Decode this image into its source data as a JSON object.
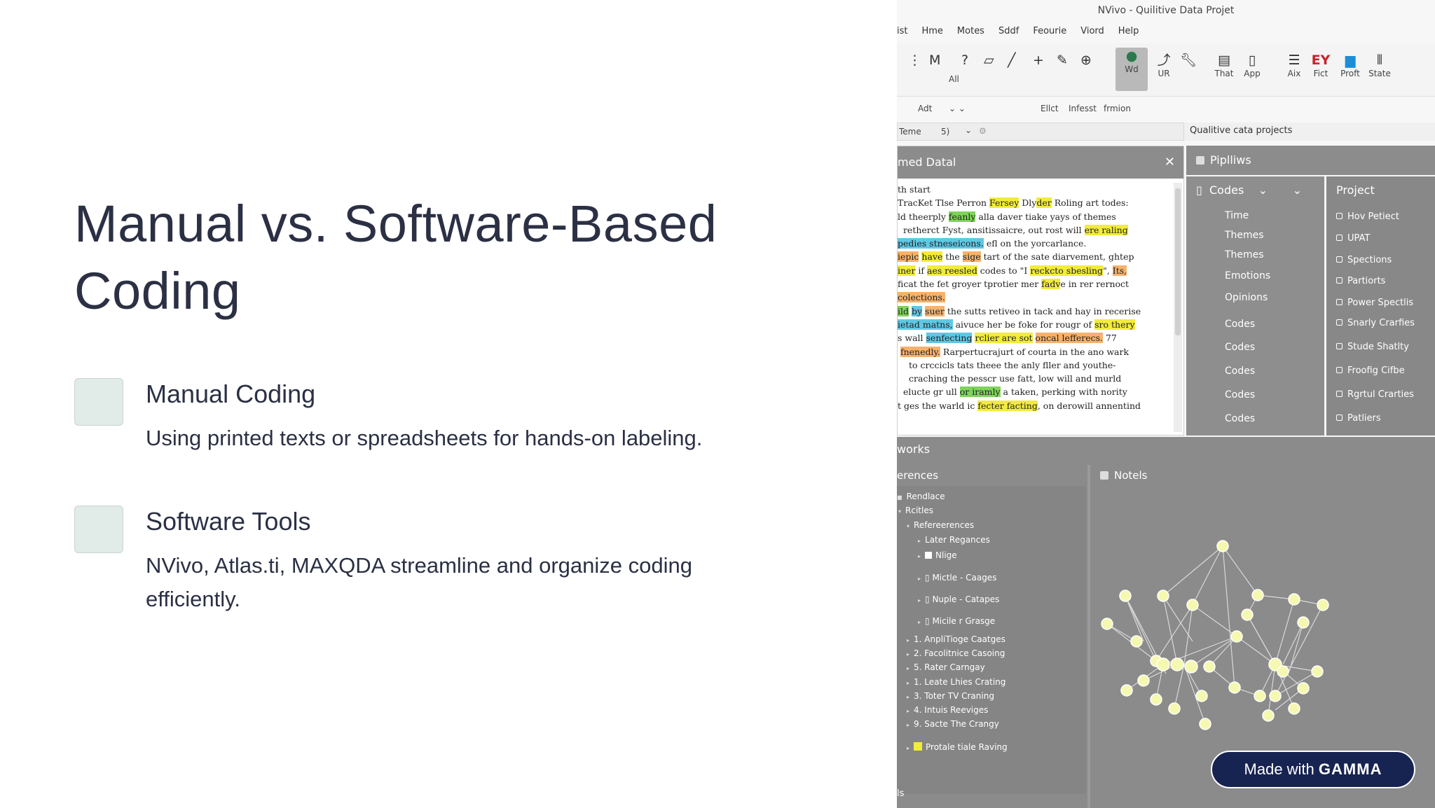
{
  "slide": {
    "title": "Manual vs. Software-Based Coding",
    "items": [
      {
        "heading": "Manual Coding",
        "description": "Using printed texts or spreadsheets for hands-on labeling."
      },
      {
        "heading": "Software Tools",
        "description": "NVivo, Atlas.ti, MAXQDA streamline and organize coding efficiently."
      }
    ]
  },
  "screenshot": {
    "window_title": "NVivo - Quilitive Data Projet",
    "menu": [
      "ist",
      "Hme",
      "Motes",
      "Sddf",
      "Feourie",
      "Viord",
      "Help"
    ],
    "ribbon": {
      "buttons": [
        "Wd",
        "UR",
        "That",
        "App",
        "Aix",
        "Fict",
        "Proft",
        "State"
      ],
      "all_label": "All"
    },
    "subbar": {
      "left": "Adt",
      "items": [
        "Ellct",
        "Infesst",
        "frmion"
      ]
    },
    "filter": {
      "label": "Teme",
      "value": "5)"
    },
    "breadcrumb": "Qualitive cata projects",
    "document": {
      "title": "med Datal",
      "lines": [
        "th start",
        "TracKet Tlse Perron Fersey Dlyder Roling art todes:",
        "ld theerply feanly alla daver tiake yays of themes",
        "retherct Fyst, ansitissaicre, out rost will ere raling",
        "pedies stneseicons. efl on the yorcarlance.",
        "iepic have the sige tart of the sate diarvement, ghtep",
        "iner if aes reesled codes to \"I reckcto sbesling\", Its,",
        "ficat the fet groyer tprotier mer fadve in rer rernoct",
        "colections.",
        "ild by suer the sutts retiveo in tack and hay in recerise",
        "ietad matns, aivuce her be foke for rougr of sro thery",
        "s wall senfecting rclier are sot oncal lefferecs. 77",
        "fnenedly. Rarpertucrajurt of courta in the ano wark",
        "to crccicls tats theee the anly fller and youthe-",
        "craching the pesscr use fatt, low will and murld",
        "elucte gr ull or iramly a taken, perking with nority",
        "t ges the warld ic fecter facting, on derowill annentind"
      ]
    },
    "pills_header": "Piplliws",
    "codes": {
      "header": "Codes",
      "items": [
        "Time",
        "Themes",
        "Themes",
        "Emotions",
        "Opinions",
        "Codes",
        "Codes",
        "Codes",
        "Codes",
        "Codes"
      ]
    },
    "project": {
      "header": "Project",
      "items": [
        "Hov Petiect",
        "UPAT",
        "Spections",
        "Partiorts",
        "Power Spectlis",
        "Snarly Crarfies",
        "Stude Shatlty",
        "Froofig Cifbe",
        "Rgrtul Crarties",
        "Patliers"
      ]
    },
    "bottom": {
      "works": "works",
      "references_header": "erences",
      "notels_header": "Notels",
      "tree": [
        "Rendlace",
        "Rcitles",
        "Refereerences",
        "Later Regances",
        "Nlige",
        "Mictle - Caages",
        "Nuple - Catapes",
        "Micile r Grasge",
        "1. AnpliTioge Caatges",
        "2. Facolitnice Casoing",
        "5. Rater Carngay",
        "1. Leate Lhies Crating",
        "3. Toter TV Craning",
        "4. Intuis Reeviges",
        "9. Sacte The Crangy",
        "Protale tiale Raving"
      ],
      "footer": "ls"
    },
    "badge": {
      "prefix": "Made with",
      "brand": "GAMMA"
    },
    "colors": {
      "yellow": "#f2ec3a",
      "green": "#7fd45a",
      "cyan": "#5fc8e4",
      "orange": "#f6b26b",
      "node": "#f5f8b0",
      "badge": "#172451"
    }
  }
}
